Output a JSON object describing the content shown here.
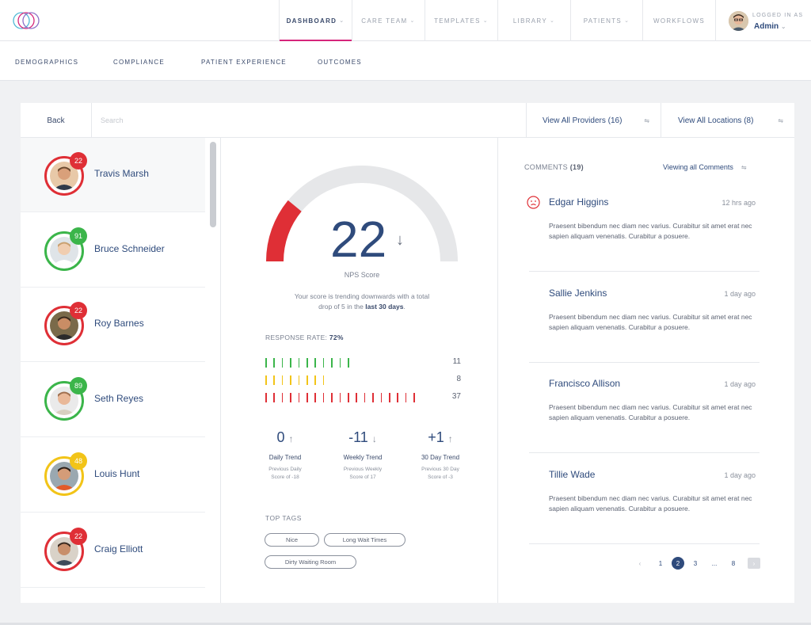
{
  "nav": {
    "items": [
      {
        "label": "Dashboard",
        "active": true
      },
      {
        "label": "Care Team"
      },
      {
        "label": "Templates"
      },
      {
        "label": "Library"
      },
      {
        "label": "Patients"
      },
      {
        "label": "Workflows"
      }
    ],
    "user": {
      "logged_in_label": "LOGGED IN AS",
      "name": "Admin"
    }
  },
  "subnav": {
    "items": [
      {
        "label": "Demographics"
      },
      {
        "label": "Compliance"
      },
      {
        "label": "Patient Experience"
      },
      {
        "label": "Outcomes"
      }
    ]
  },
  "toolbar": {
    "back_label": "Back",
    "search_placeholder": "Search",
    "filters": [
      {
        "label": "View All Providers (16)"
      },
      {
        "label": "View All Locations (8)"
      }
    ]
  },
  "providers": [
    {
      "name": "Travis Marsh",
      "score": "22",
      "status": "red",
      "selected": true
    },
    {
      "name": "Bruce Schneider",
      "score": "91",
      "status": "green"
    },
    {
      "name": "Roy Barnes",
      "score": "22",
      "status": "red"
    },
    {
      "name": "Seth Reyes",
      "score": "89",
      "status": "green"
    },
    {
      "name": "Louis Hunt",
      "score": "48",
      "status": "yellow"
    },
    {
      "name": "Craig Elliott",
      "score": "22",
      "status": "red"
    }
  ],
  "colors": {
    "red": "#df2f36",
    "green": "#3bb54a",
    "yellow": "#f2c418",
    "navy": "#2f4b7c",
    "accent": "#d6257b"
  },
  "nps": {
    "value": "22",
    "gauge_fraction": 0.22,
    "label": "NPS Score",
    "desc_prefix": "Your score is trending downwards with a total drop of 5 in the ",
    "desc_bold": "last 30 days",
    "desc_suffix": "."
  },
  "response_rate": {
    "label": "RESPONSE RATE: ",
    "value": "72%",
    "rows": [
      {
        "color": "green",
        "ticks": 11,
        "count": "11"
      },
      {
        "color": "yellow",
        "ticks": 8,
        "count": "8"
      },
      {
        "color": "red",
        "ticks": 19,
        "count": "37"
      }
    ]
  },
  "trends": [
    {
      "value": "0",
      "arrow": "up",
      "label": "Daily Trend",
      "prev_line1": "Previous Daily",
      "prev_line2": "Score of -18"
    },
    {
      "value": "-11",
      "arrow": "down",
      "label": "Weekly Trend",
      "prev_line1": "Previous Weekly",
      "prev_line2": "Score of 17"
    },
    {
      "value": "+1",
      "arrow": "up",
      "label": "30 Day Trend",
      "prev_line1": "Previous 30 Day",
      "prev_line2": "Score of -3"
    }
  ],
  "tags": {
    "label": "TOP TAGS",
    "items": [
      "Nice",
      "Long Wait Times",
      "Dirty Waiting Room"
    ]
  },
  "comments": {
    "header_label": "COMMENTS",
    "count": "(19)",
    "view_label": "Viewing all Comments",
    "items": [
      {
        "author": "Edgar Higgins",
        "time": "12 hrs ago",
        "text": "Praesent bibendum nec diam nec varius. Curabitur sit amet erat nec sapien aliquam venenatis. Curabitur a posuere.",
        "icon": "sad-face-icon"
      },
      {
        "author": "Sallie Jenkins",
        "time": "1 day ago",
        "text": "Praesent bibendum nec diam nec varius. Curabitur sit amet erat nec sapien aliquam venenatis. Curabitur a posuere."
      },
      {
        "author": "Francisco Allison",
        "time": "1 day ago",
        "text": "Praesent bibendum nec diam nec varius. Curabitur sit amet erat nec sapien aliquam venenatis. Curabitur a posuere."
      },
      {
        "author": "Tillie Wade",
        "time": "1 day ago",
        "text": "Praesent bibendum nec diam nec varius. Curabitur sit amet erat nec sapien aliquam venenatis. Curabitur a posuere."
      }
    ],
    "pagination": {
      "prev": "‹",
      "pages": [
        "1",
        "2",
        "3",
        "...",
        "8"
      ],
      "current": "2",
      "next": "›"
    }
  }
}
